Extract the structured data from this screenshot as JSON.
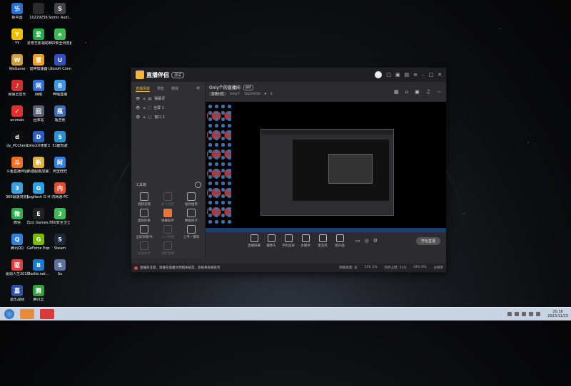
{
  "desktop": {
    "icons": [
      {
        "label": "新中国",
        "color": "#2a6fd0",
        "glyph": "卐"
      },
      {
        "label": "10229256",
        "color": "#2b2b2b",
        "glyph": ""
      },
      {
        "label": "Somic Audi...",
        "color": "#444444",
        "glyph": "S"
      },
      {
        "label": "YY",
        "color": "#f0c000",
        "glyph": "Y"
      },
      {
        "label": "爱奇艺影视助手",
        "color": "#22aa44",
        "glyph": "爱"
      },
      {
        "label": "360安全浏览器",
        "color": "#3cba54",
        "glyph": "e"
      },
      {
        "label": "WeGame",
        "color": "#d0a040",
        "glyph": "W"
      },
      {
        "label": "雷神加速器",
        "color": "#f0a020",
        "glyph": "雷"
      },
      {
        "label": "Ubisoft Connect",
        "color": "#3050c0",
        "glyph": "U"
      },
      {
        "label": "网易云音乐",
        "color": "#d03030",
        "glyph": "♪"
      },
      {
        "label": "网络",
        "color": "#3070d0",
        "glyph": "网"
      },
      {
        "label": "哔哩直播",
        "color": "#3c96e8",
        "glyph": "B"
      },
      {
        "label": "animals",
        "color": "#e03030",
        "glyph": "✓"
      },
      {
        "label": "回收站",
        "color": "#5a6070",
        "glyph": "回"
      },
      {
        "label": "瓶吉他",
        "color": "#3a6ab0",
        "glyph": "瓶"
      },
      {
        "label": "dy_PCClient",
        "color": "#111111",
        "glyph": "d"
      },
      {
        "label": "DirectX修复工具",
        "color": "#2a60c0",
        "glyph": "D"
      },
      {
        "label": "51酷驾驶",
        "color": "#2a90d0",
        "glyph": "5"
      },
      {
        "label": "斗鱼直播伴侣",
        "color": "#f07020",
        "glyph": "斗"
      },
      {
        "label": "新建超级加速工具",
        "color": "#e0b040",
        "glyph": "新"
      },
      {
        "label": "阿里旺旺",
        "color": "#3080e0",
        "glyph": "阿"
      },
      {
        "label": "360极速浏览器",
        "color": "#3aa0e0",
        "glyph": "3"
      },
      {
        "label": "Logitech G HUB",
        "color": "#2aa0e0",
        "glyph": "G"
      },
      {
        "label": "内网通-PC",
        "color": "#e05030",
        "glyph": "内"
      },
      {
        "label": "微信",
        "color": "#30b050",
        "glyph": "微"
      },
      {
        "label": "Epic Games Launcher",
        "color": "#222222",
        "glyph": "E"
      },
      {
        "label": "360安全卫士",
        "color": "#3cba54",
        "glyph": "3"
      },
      {
        "label": "腾讯QQ",
        "color": "#3080e0",
        "glyph": "Q"
      },
      {
        "label": "GeForce Experience",
        "color": "#76b900",
        "glyph": "G"
      },
      {
        "label": "Steam",
        "color": "#1b2838",
        "glyph": "S"
      },
      {
        "label": "驱动人生2010年版",
        "color": "#e04040",
        "glyph": "驱"
      },
      {
        "label": "Battle.net...",
        "color": "#1a7ad0",
        "glyph": "B"
      },
      {
        "label": "So",
        "color": "#6070a0",
        "glyph": "S"
      },
      {
        "label": "嘉乐战网",
        "color": "#3050a0",
        "glyph": "嘉"
      },
      {
        "label": "腾讯云",
        "color": "#30a040",
        "glyph": "腾"
      }
    ]
  },
  "app": {
    "brand": "直播伴侣",
    "version_badge": "测试",
    "tabs": [
      "直播场景",
      "预告",
      "特效"
    ],
    "tab_add": "+",
    "scenes": [
      {
        "label": "弹幕评"
      },
      {
        "label": "全屏 1"
      },
      {
        "label": "窗口 1"
      }
    ],
    "tools_title": "工具箱",
    "tools": [
      {
        "label": "视频滤镜"
      },
      {
        "label": "多人连麦"
      },
      {
        "label": "插件推荐"
      },
      {
        "label": "虚拟形象"
      },
      {
        "label": "弹幕助手"
      },
      {
        "label": "数据统计"
      },
      {
        "label": "全屏场景PK"
      },
      {
        "label": "人力直播"
      },
      {
        "label": "上传一键同"
      },
      {
        "label": "等级助手"
      },
      {
        "label": "进阶直播"
      }
    ],
    "room_title": "Only个的直播间",
    "room_edit": "编辑",
    "room_category": "直播分区",
    "room_user": "Only个",
    "room_id": "10229256",
    "room_likes": "0",
    "controls": [
      {
        "label": "直播屏幕"
      },
      {
        "label": "摄像头"
      },
      {
        "label": "手机投屏"
      },
      {
        "label": "多媒体"
      },
      {
        "label": "麦克风"
      },
      {
        "label": "扬声器"
      }
    ],
    "start_label": "开始直播",
    "notice": "直播前注意，请遵守直播文明相关规定，违规将会被处罚",
    "stats": [
      "网络质量: 良",
      "CPU 2%",
      "内存占用: 31%",
      "GPU 0%",
      "分辨率"
    ],
    "status_color": "#e04b3b",
    "accent": "#f2b53a"
  },
  "taskbar": {
    "time": "20:36",
    "date": "2023/11/23"
  }
}
